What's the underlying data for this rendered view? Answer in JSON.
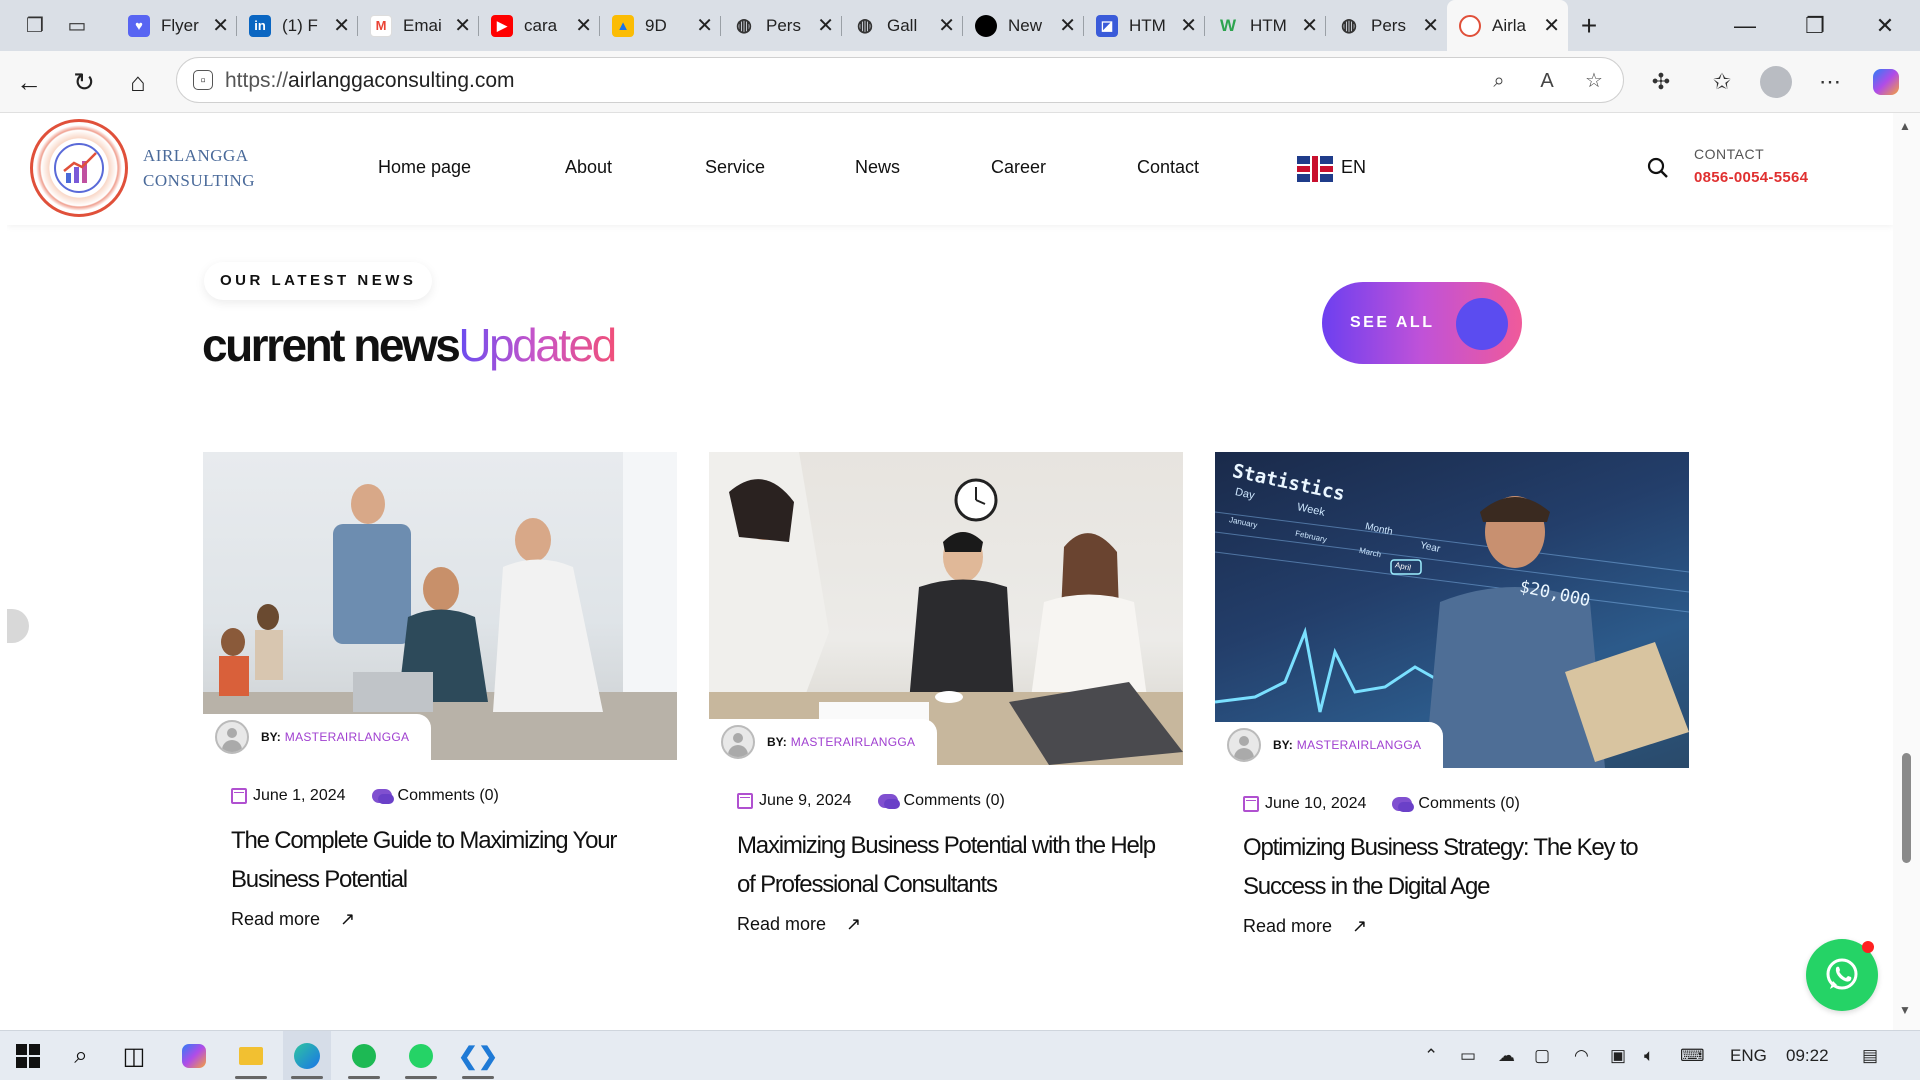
{
  "browser": {
    "tabs": [
      {
        "title": "Flyer",
        "favicon": "heart-icon",
        "color": "#5865f2"
      },
      {
        "title": "(1) F",
        "favicon": "linkedin-icon",
        "color": "#0a66c2"
      },
      {
        "title": "Emai",
        "favicon": "gmail-icon",
        "color": "#ea4335"
      },
      {
        "title": "cara",
        "favicon": "youtube-icon",
        "color": "#ff0000"
      },
      {
        "title": "9D",
        "favicon": "drive-icon",
        "color": "#34a853"
      },
      {
        "title": "Pers",
        "favicon": "globe-icon",
        "color": "#555555"
      },
      {
        "title": "Gall",
        "favicon": "globe-icon",
        "color": "#555555"
      },
      {
        "title": "New",
        "favicon": "circle-icon",
        "color": "#000000"
      },
      {
        "title": "HTM",
        "favicon": "app-icon",
        "color": "#3a5bd9"
      },
      {
        "title": "HTM",
        "favicon": "w-icon",
        "color": "#2ea44f"
      },
      {
        "title": "Pers",
        "favicon": "globe-icon",
        "color": "#555555"
      },
      {
        "title": "Airla",
        "favicon": "logo-icon",
        "color": "#e0503a"
      }
    ],
    "url_scheme": "https://",
    "url_host": "airlanggaconsulting.com"
  },
  "site": {
    "brand_line1": "AIRLANGGA",
    "brand_line2": "CONSULTING",
    "menu": [
      "Home page",
      "About",
      "Service",
      "News",
      "Career",
      "Contact"
    ],
    "language": "EN",
    "contact_label": "CONTACT",
    "contact_phone": "0856-0054-5564",
    "eyebrow": "OUR LATEST NEWS",
    "heading_main": "current news",
    "heading_accent": "Updated",
    "see_all": "SEE ALL",
    "accent_colors": [
      "#6d3ff0",
      "#c052d8",
      "#f05a9a"
    ]
  },
  "cards": [
    {
      "author_prefix": "BY:",
      "author": "MASTERAIRLANGGA",
      "date": "June 1, 2024",
      "comments": "Comments (0)",
      "title": "The Complete Guide to Maximizing Your Business Potential",
      "read_more": "Read more"
    },
    {
      "author_prefix": "BY:",
      "author": "MASTERAIRLANGGA",
      "date": "June 9, 2024",
      "comments": "Comments (0)",
      "title": "Maximizing Business Potential with the Help of Professional Consultants",
      "read_more": "Read more"
    },
    {
      "author_prefix": "BY:",
      "author": "MASTERAIRLANGGA",
      "date": "June 10, 2024",
      "comments": "Comments (0)",
      "title": "Optimizing Business Strategy: The Key to Success in the Digital Age",
      "read_more": "Read more",
      "image_overlay": {
        "label": "Statistics",
        "period_labels": [
          "Day",
          "Week",
          "Month",
          "Year"
        ],
        "months": [
          "January",
          "February",
          "March",
          "April"
        ],
        "amount": "$20,000"
      }
    }
  ],
  "taskbar": {
    "language": "ENG",
    "time": "09:22"
  }
}
